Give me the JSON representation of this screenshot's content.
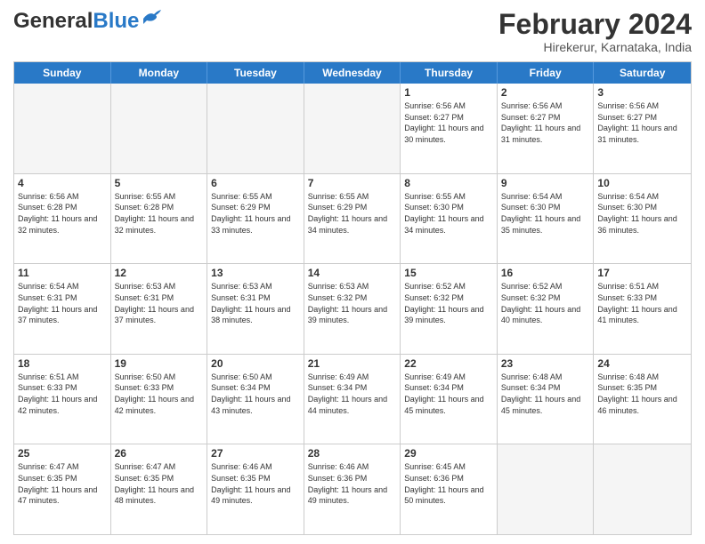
{
  "header": {
    "logo": {
      "general": "General",
      "blue": "Blue"
    },
    "title": "February 2024",
    "location": "Hirekerur, Karnataka, India"
  },
  "weekdays": [
    "Sunday",
    "Monday",
    "Tuesday",
    "Wednesday",
    "Thursday",
    "Friday",
    "Saturday"
  ],
  "weeks": [
    [
      {
        "day": "",
        "empty": true
      },
      {
        "day": "",
        "empty": true
      },
      {
        "day": "",
        "empty": true
      },
      {
        "day": "",
        "empty": true
      },
      {
        "day": "1",
        "sunrise": "Sunrise: 6:56 AM",
        "sunset": "Sunset: 6:27 PM",
        "daylight": "Daylight: 11 hours and 30 minutes."
      },
      {
        "day": "2",
        "sunrise": "Sunrise: 6:56 AM",
        "sunset": "Sunset: 6:27 PM",
        "daylight": "Daylight: 11 hours and 31 minutes."
      },
      {
        "day": "3",
        "sunrise": "Sunrise: 6:56 AM",
        "sunset": "Sunset: 6:27 PM",
        "daylight": "Daylight: 11 hours and 31 minutes."
      }
    ],
    [
      {
        "day": "4",
        "sunrise": "Sunrise: 6:56 AM",
        "sunset": "Sunset: 6:28 PM",
        "daylight": "Daylight: 11 hours and 32 minutes."
      },
      {
        "day": "5",
        "sunrise": "Sunrise: 6:55 AM",
        "sunset": "Sunset: 6:28 PM",
        "daylight": "Daylight: 11 hours and 32 minutes."
      },
      {
        "day": "6",
        "sunrise": "Sunrise: 6:55 AM",
        "sunset": "Sunset: 6:29 PM",
        "daylight": "Daylight: 11 hours and 33 minutes."
      },
      {
        "day": "7",
        "sunrise": "Sunrise: 6:55 AM",
        "sunset": "Sunset: 6:29 PM",
        "daylight": "Daylight: 11 hours and 34 minutes."
      },
      {
        "day": "8",
        "sunrise": "Sunrise: 6:55 AM",
        "sunset": "Sunset: 6:30 PM",
        "daylight": "Daylight: 11 hours and 34 minutes."
      },
      {
        "day": "9",
        "sunrise": "Sunrise: 6:54 AM",
        "sunset": "Sunset: 6:30 PM",
        "daylight": "Daylight: 11 hours and 35 minutes."
      },
      {
        "day": "10",
        "sunrise": "Sunrise: 6:54 AM",
        "sunset": "Sunset: 6:30 PM",
        "daylight": "Daylight: 11 hours and 36 minutes."
      }
    ],
    [
      {
        "day": "11",
        "sunrise": "Sunrise: 6:54 AM",
        "sunset": "Sunset: 6:31 PM",
        "daylight": "Daylight: 11 hours and 37 minutes."
      },
      {
        "day": "12",
        "sunrise": "Sunrise: 6:53 AM",
        "sunset": "Sunset: 6:31 PM",
        "daylight": "Daylight: 11 hours and 37 minutes."
      },
      {
        "day": "13",
        "sunrise": "Sunrise: 6:53 AM",
        "sunset": "Sunset: 6:31 PM",
        "daylight": "Daylight: 11 hours and 38 minutes."
      },
      {
        "day": "14",
        "sunrise": "Sunrise: 6:53 AM",
        "sunset": "Sunset: 6:32 PM",
        "daylight": "Daylight: 11 hours and 39 minutes."
      },
      {
        "day": "15",
        "sunrise": "Sunrise: 6:52 AM",
        "sunset": "Sunset: 6:32 PM",
        "daylight": "Daylight: 11 hours and 39 minutes."
      },
      {
        "day": "16",
        "sunrise": "Sunrise: 6:52 AM",
        "sunset": "Sunset: 6:32 PM",
        "daylight": "Daylight: 11 hours and 40 minutes."
      },
      {
        "day": "17",
        "sunrise": "Sunrise: 6:51 AM",
        "sunset": "Sunset: 6:33 PM",
        "daylight": "Daylight: 11 hours and 41 minutes."
      }
    ],
    [
      {
        "day": "18",
        "sunrise": "Sunrise: 6:51 AM",
        "sunset": "Sunset: 6:33 PM",
        "daylight": "Daylight: 11 hours and 42 minutes."
      },
      {
        "day": "19",
        "sunrise": "Sunrise: 6:50 AM",
        "sunset": "Sunset: 6:33 PM",
        "daylight": "Daylight: 11 hours and 42 minutes."
      },
      {
        "day": "20",
        "sunrise": "Sunrise: 6:50 AM",
        "sunset": "Sunset: 6:34 PM",
        "daylight": "Daylight: 11 hours and 43 minutes."
      },
      {
        "day": "21",
        "sunrise": "Sunrise: 6:49 AM",
        "sunset": "Sunset: 6:34 PM",
        "daylight": "Daylight: 11 hours and 44 minutes."
      },
      {
        "day": "22",
        "sunrise": "Sunrise: 6:49 AM",
        "sunset": "Sunset: 6:34 PM",
        "daylight": "Daylight: 11 hours and 45 minutes."
      },
      {
        "day": "23",
        "sunrise": "Sunrise: 6:48 AM",
        "sunset": "Sunset: 6:34 PM",
        "daylight": "Daylight: 11 hours and 45 minutes."
      },
      {
        "day": "24",
        "sunrise": "Sunrise: 6:48 AM",
        "sunset": "Sunset: 6:35 PM",
        "daylight": "Daylight: 11 hours and 46 minutes."
      }
    ],
    [
      {
        "day": "25",
        "sunrise": "Sunrise: 6:47 AM",
        "sunset": "Sunset: 6:35 PM",
        "daylight": "Daylight: 11 hours and 47 minutes."
      },
      {
        "day": "26",
        "sunrise": "Sunrise: 6:47 AM",
        "sunset": "Sunset: 6:35 PM",
        "daylight": "Daylight: 11 hours and 48 minutes."
      },
      {
        "day": "27",
        "sunrise": "Sunrise: 6:46 AM",
        "sunset": "Sunset: 6:35 PM",
        "daylight": "Daylight: 11 hours and 49 minutes."
      },
      {
        "day": "28",
        "sunrise": "Sunrise: 6:46 AM",
        "sunset": "Sunset: 6:36 PM",
        "daylight": "Daylight: 11 hours and 49 minutes."
      },
      {
        "day": "29",
        "sunrise": "Sunrise: 6:45 AM",
        "sunset": "Sunset: 6:36 PM",
        "daylight": "Daylight: 11 hours and 50 minutes."
      },
      {
        "day": "",
        "empty": true
      },
      {
        "day": "",
        "empty": true
      }
    ]
  ]
}
